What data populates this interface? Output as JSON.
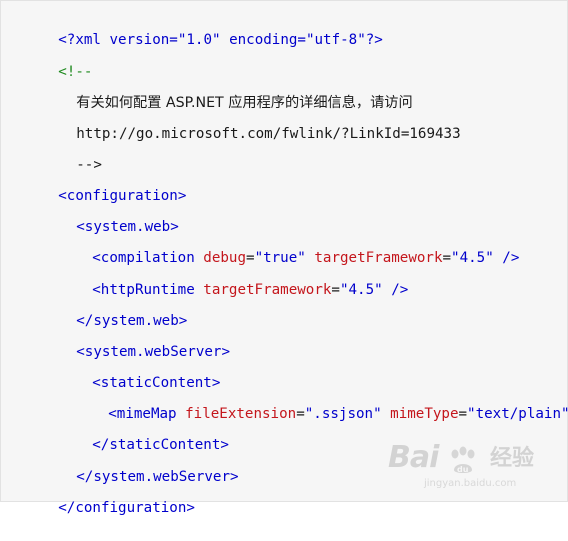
{
  "code": {
    "xml_decl": "<?xml version=\"1.0\" encoding=\"utf-8\"?>",
    "comment_open": "<!--",
    "comment_line1": "有关如何配置 ASP.NET 应用程序的详细信息，请访问",
    "comment_line2": "http://go.microsoft.com/fwlink/?LinkId=169433",
    "comment_close": "-->",
    "configuration_open": "<configuration>",
    "system_web_open": "<system.web>",
    "compilation": {
      "tag": "<compilation",
      "attr1_name": "debug",
      "attr1_value": "\"true\"",
      "attr2_name": "targetFramework",
      "attr2_value": "\"4.5\"",
      "close": "/>"
    },
    "httpRuntime": {
      "tag": "<httpRuntime",
      "attr1_name": "targetFramework",
      "attr1_value": "\"4.5\"",
      "close": "/>"
    },
    "system_web_close": "</system.web>",
    "system_webserver_open": "<system.webServer>",
    "staticcontent_open": "<staticContent>",
    "mimemap": {
      "tag": "<mimeMap",
      "attr1_name": "fileExtension",
      "attr1_value": "\".ssjson\"",
      "attr2_name": "mimeType",
      "attr2_value": "\"text/plain\"",
      "close": "/>"
    },
    "staticcontent_close": "</staticContent>",
    "system_webserver_close": "</system.webServer>",
    "configuration_close": "</configuration>"
  },
  "watermark": {
    "logo_text": "Bai",
    "paw_text": "du",
    "cn_text": "经验",
    "url": "jingyan.baidu.com"
  },
  "colors": {
    "tag": "#0000cc",
    "attribute": "#c4161c",
    "value": "#0000cc",
    "comment": "#1f8a1f",
    "background": "#f6f6f6"
  }
}
